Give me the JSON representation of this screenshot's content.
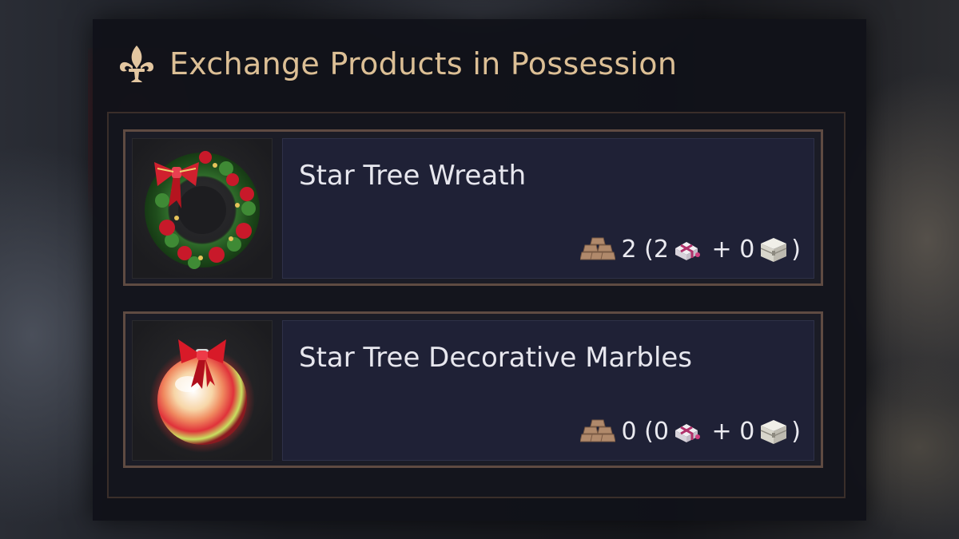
{
  "panel": {
    "title": "Exchange Products in Possession",
    "accent_color": "#dcbf95"
  },
  "items": [
    {
      "name": "Star Tree Wreath",
      "icon": "wreath-icon",
      "total": "2",
      "open_paren": "(",
      "bundle_count": "2",
      "plus": "+",
      "box_count": "0",
      "close_paren": ")"
    },
    {
      "name": "Star Tree Decorative Marbles",
      "icon": "ornament-icon",
      "total": "0",
      "open_paren": "(",
      "bundle_count": "0",
      "plus": "+",
      "box_count": "0",
      "close_paren": ")"
    }
  ],
  "icons": {
    "header": "fleur-de-lis-icon",
    "stack": "gold-bars-icon",
    "bundle": "gift-bundle-icon",
    "box": "treasure-box-icon"
  }
}
